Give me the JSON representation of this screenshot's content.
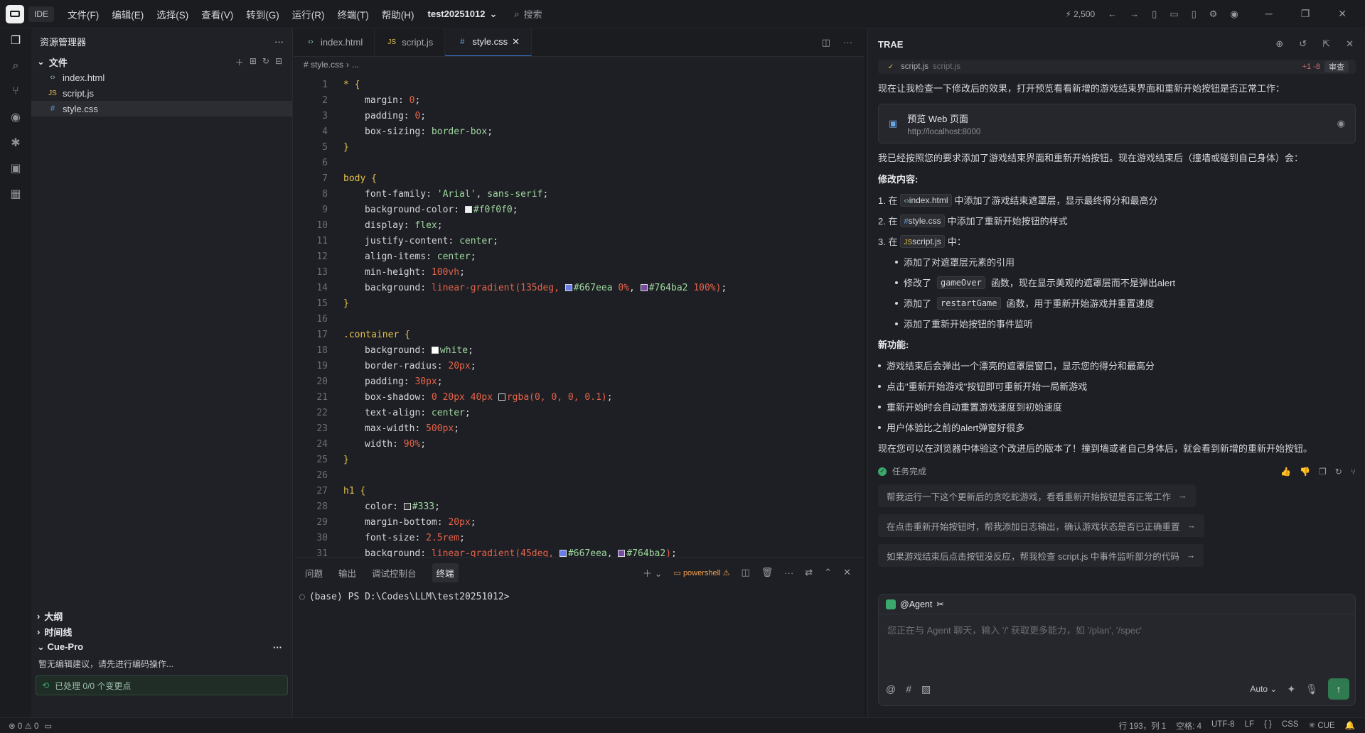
{
  "titlebar": {
    "ide_label": "IDE",
    "menu": [
      "文件(F)",
      "编辑(E)",
      "选择(S)",
      "查看(V)",
      "转到(G)",
      "运行(R)",
      "终端(T)",
      "帮助(H)"
    ],
    "project": "test20251012",
    "search_placeholder": "搜索",
    "credits": "2,500"
  },
  "explorer": {
    "title": "资源管理器",
    "folder": "文件",
    "files": [
      {
        "name": "index.html",
        "type": "html",
        "icon": "‹›"
      },
      {
        "name": "script.js",
        "type": "js",
        "icon": "JS"
      },
      {
        "name": "style.css",
        "type": "css",
        "icon": "#"
      }
    ],
    "outline": "大纲",
    "timeline": "时间线",
    "cue_title": "Cue-Pro",
    "cue_text": "暂无编辑建议，请先进行编码操作...",
    "cue_status": "已处理 0/0 个变更点"
  },
  "editor": {
    "tabs": [
      {
        "label": "index.html",
        "icon": "‹›"
      },
      {
        "label": "script.js",
        "icon": "JS"
      },
      {
        "label": "style.css",
        "icon": "#"
      }
    ],
    "breadcrumb": [
      "# style.css",
      "..."
    ],
    "line_numbers": [
      "1",
      "2",
      "3",
      "4",
      "5",
      "6",
      "7",
      "8",
      "9",
      "10",
      "11",
      "12",
      "13",
      "14",
      "15",
      "16",
      "17",
      "18",
      "19",
      "20",
      "21",
      "22",
      "23",
      "24",
      "25",
      "26",
      "27",
      "28",
      "29",
      "30",
      "31"
    ]
  },
  "panel": {
    "tabs": [
      "问题",
      "输出",
      "调试控制台",
      "终端"
    ],
    "shell": "powershell",
    "prompt": "(base) PS D:\\Codes\\LLM\\test20251012>"
  },
  "ai": {
    "title": "TRAE",
    "top_file": "script.js",
    "top_file_path": "script.js",
    "top_diff": "+1 -8",
    "top_review": "审查",
    "intro": "现在让我检查一下修改后的效果，打开预览看看新增的游戏结束界面和重新开始按钮是否正常工作：",
    "preview_title": "预览 Web 页面",
    "preview_url": "http://localhost:8000",
    "summary": "我已经按照您的要求添加了游戏结束界面和重新开始按钮。现在游戏结束后（撞墙或碰到自己身体）会：",
    "changes_title": "修改内容:",
    "changes": [
      {
        "num": "1. 在",
        "file": "index.html",
        "icon": "‹›",
        "text": "中添加了游戏结束遮罩层，显示最终得分和最高分"
      },
      {
        "num": "2. 在",
        "file": "style.css",
        "icon": "#",
        "text": "中添加了重新开始按钮的样式"
      },
      {
        "num": "3. 在",
        "file": "script.js",
        "icon": "JS",
        "text": "中："
      }
    ],
    "sub_items": [
      {
        "pre": "添加了对遮罩层元素的引用",
        "code": "",
        "post": ""
      },
      {
        "pre": "修改了",
        "code": "gameOver",
        "post": "函数，现在显示美观的遮罩层而不是弹出alert"
      },
      {
        "pre": "添加了",
        "code": "restartGame",
        "post": "函数，用于重新开始游戏并重置速度"
      },
      {
        "pre": "添加了重新开始按钮的事件监听",
        "code": "",
        "post": ""
      }
    ],
    "features_title": "新功能:",
    "features": [
      "游戏结束后会弹出一个漂亮的遮罩层窗口，显示您的得分和最高分",
      "点击\"重新开始游戏\"按钮即可重新开始一局新游戏",
      "重新开始时会自动重置游戏速度到初始速度",
      "用户体验比之前的alert弹窗好很多"
    ],
    "closing": "现在您可以在浏览器中体验这个改进后的版本了！撞到墙或者自己身体后，就会看到新增的重新开始按钮。",
    "done": "任务完成",
    "suggestions": [
      "帮我运行一下这个更新后的贪吃蛇游戏，看看重新开始按钮是否正常工作",
      "在点击重新开始按钮时，帮我添加日志输出，确认游戏状态是否已正确重置",
      "如果游戏结束后点击按钮没反应，帮我检查 script.js 中事件监听部分的代码"
    ],
    "agent_label": "@Agent",
    "input_placeholder": "您正在与 Agent 聊天，输入 '/' 获取更多能力，如 '/plan', '/spec'",
    "mode": "Auto"
  },
  "statusbar": {
    "errors": "0",
    "warnings": "0",
    "position": "行 193，列 1",
    "spaces": "空格: 4",
    "encoding": "UTF-8",
    "eol": "LF",
    "braces": "{ }",
    "language": "CSS",
    "cue": "CUE"
  },
  "colors": {
    "accent": "#3a7bd5",
    "success": "#3aa96b"
  }
}
